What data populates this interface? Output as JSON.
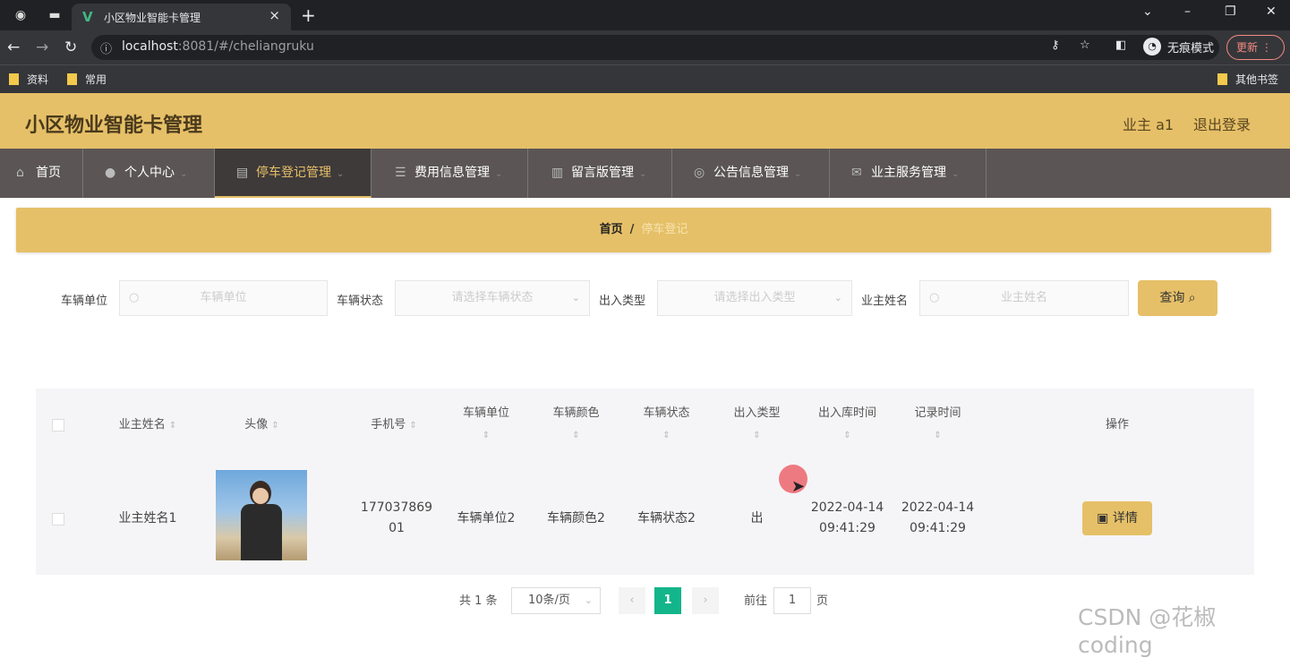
{
  "browser": {
    "tab_title": "小区物业智能卡管理",
    "url_host": "localhost",
    "url_rest": ":8081/#/cheliangruku",
    "incognito_label": "无痕模式",
    "update_label": "更新",
    "bookmarks": [
      "资料",
      "常用"
    ],
    "other_bookmarks": "其他书签"
  },
  "header": {
    "title": "小区物业智能卡管理",
    "user": "业主 a1",
    "logout": "退出登录"
  },
  "menu": [
    {
      "label": "首页",
      "icon": "home-icon"
    },
    {
      "label": "个人中心",
      "icon": "user-icon"
    },
    {
      "label": "停车登记管理",
      "icon": "briefcase-icon",
      "active": true
    },
    {
      "label": "费用信息管理",
      "icon": "list-icon"
    },
    {
      "label": "留言版管理",
      "icon": "document-icon"
    },
    {
      "label": "公告信息管理",
      "icon": "circle-icon"
    },
    {
      "label": "业主服务管理",
      "icon": "mail-icon"
    }
  ],
  "breadcrumb": {
    "home": "首页",
    "sep": "/",
    "current": "停车登记"
  },
  "search": {
    "vehicle_unit_label": "车辆单位",
    "vehicle_unit_placeholder": "车辆单位",
    "vehicle_status_label": "车辆状态",
    "vehicle_status_placeholder": "请选择车辆状态",
    "inout_type_label": "出入类型",
    "inout_type_placeholder": "请选择出入类型",
    "owner_name_label": "业主姓名",
    "owner_name_placeholder": "业主姓名",
    "query_button": "查询"
  },
  "table": {
    "headers": {
      "owner_name": "业主姓名",
      "avatar": "头像",
      "phone": "手机号",
      "vehicle_unit": "车辆单位",
      "vehicle_color": "车辆颜色",
      "vehicle_status": "车辆状态",
      "inout_type": "出入类型",
      "inout_time": "出入库时间",
      "record_time": "记录时间",
      "actions": "操作"
    },
    "rows": [
      {
        "owner_name": "业主姓名1",
        "phone_l1": "177037869",
        "phone_l2": "01",
        "vehicle_unit": "车辆单位2",
        "vehicle_color": "车辆颜色2",
        "vehicle_status": "车辆状态2",
        "inout_type": "出",
        "inout_date": "2022-04-14",
        "inout_time": "09:41:29",
        "record_date": "2022-04-14",
        "record_time": "09:41:29",
        "detail_button": "详情"
      }
    ]
  },
  "pagination": {
    "total": "共 1 条",
    "page_size": "10条/页",
    "current_page": "1",
    "goto_label": "前往",
    "goto_value": "1",
    "page_suffix": "页"
  },
  "watermark": "CSDN @花椒coding"
}
